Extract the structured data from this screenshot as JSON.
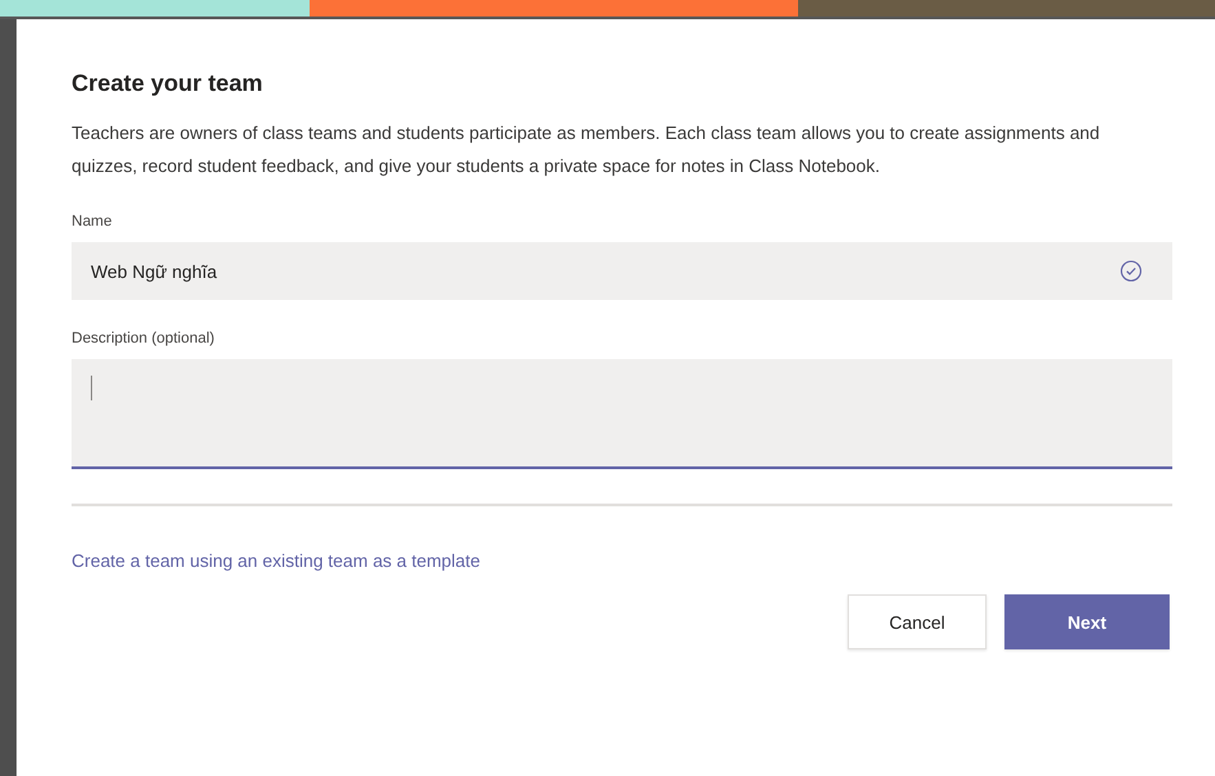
{
  "dialog": {
    "title": "Create your team",
    "description": "Teachers are owners of class teams and students participate as members. Each class team allows you to create assignments and quizzes, record student feedback, and give your students a private space for notes in Class Notebook.",
    "fields": [
      {
        "kind": "text",
        "label": "Name",
        "value": "Web Ngữ nghĩa",
        "valid": true
      },
      {
        "kind": "textarea",
        "label": "Description (optional)",
        "focused": true
      }
    ],
    "template_link": "Create a team using an existing team as a template",
    "buttons": [
      {
        "label": "Cancel",
        "primary": false
      },
      {
        "label": "Next",
        "primary": true
      }
    ]
  }
}
